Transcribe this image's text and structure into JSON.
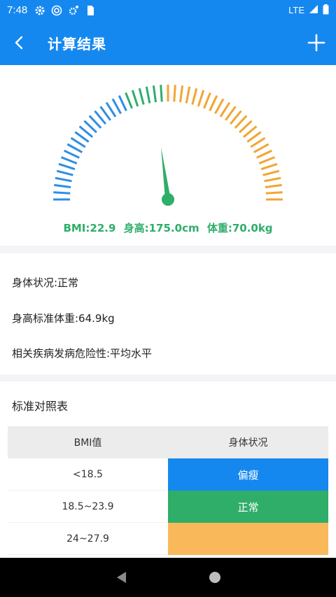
{
  "status_bar": {
    "time": "7:48",
    "network": "LTE"
  },
  "app_bar": {
    "title": "计算结果"
  },
  "gauge": {
    "bmi": "BMI:22.9",
    "height": "身高:175.0cm",
    "weight": "体重:70.0kg",
    "colors": {
      "low": "#2f8de4",
      "normal": "#2fae6a",
      "high": "#f0a631"
    }
  },
  "info": {
    "body_status": "身体状况:正常",
    "standard_weight": "身高标准体重:64.9kg",
    "disease_risk": "相关疾病发病危险性:平均水平"
  },
  "table": {
    "title": "标准对照表",
    "header": [
      "BMI值",
      "身体状况"
    ],
    "rows": [
      {
        "range": "<18.5",
        "status": "偏瘦",
        "color": "#1588f0"
      },
      {
        "range": "18.5~23.9",
        "status": "正常",
        "color": "#2fae6a"
      },
      {
        "range": "24~27.9",
        "status": "",
        "color": "#f9b95b"
      }
    ]
  }
}
